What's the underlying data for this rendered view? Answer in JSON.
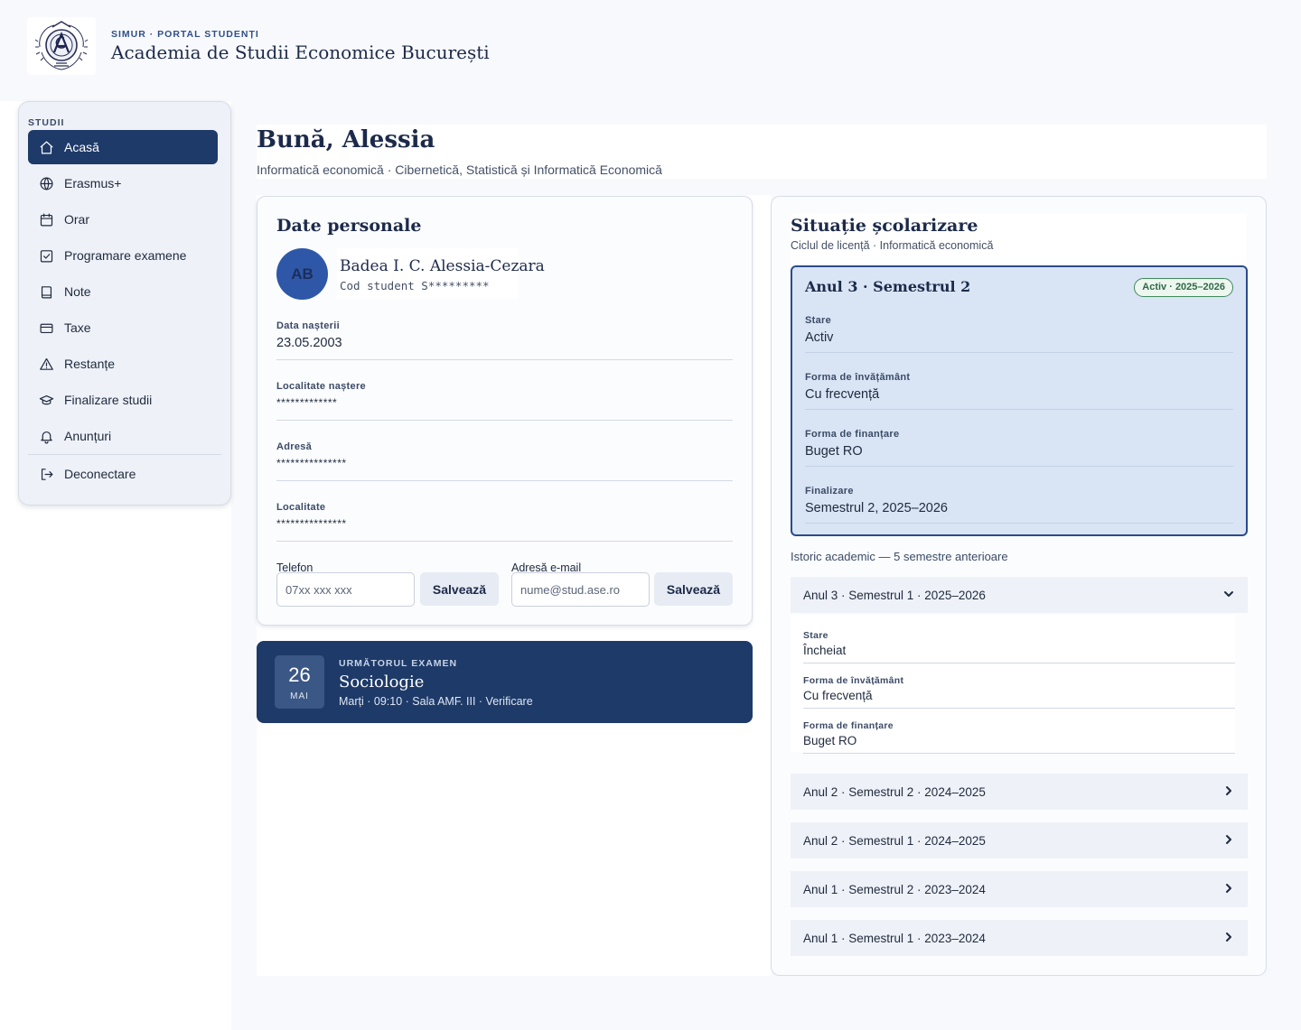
{
  "header": {
    "kicker": "SIMUR · PORTAL STUDENȚI",
    "title": "Academia de Studii Economice București"
  },
  "sidebar": {
    "section": "STUDII",
    "items": [
      {
        "label": "Acasă",
        "icon": "home-icon",
        "active": true
      },
      {
        "label": "Erasmus+",
        "icon": "globe-icon"
      },
      {
        "label": "Orar",
        "icon": "calendar-icon"
      },
      {
        "label": "Programare examene",
        "icon": "calendar-check-icon"
      },
      {
        "label": "Note",
        "icon": "book-icon"
      },
      {
        "label": "Taxe",
        "icon": "credit-card-icon"
      },
      {
        "label": "Restanțe",
        "icon": "warning-icon"
      },
      {
        "label": "Finalizare studii",
        "icon": "graduation-cap-icon"
      },
      {
        "label": "Anunțuri",
        "icon": "bell-icon"
      },
      {
        "label": "Deconectare",
        "icon": "logout-icon"
      }
    ]
  },
  "greeting": {
    "title": "Bună, Alessia",
    "subtitle": "Informatică economică · Cibernetică, Statistică și Informatică Economică"
  },
  "personal": {
    "title": "Date personale",
    "avatar_initials": "AB",
    "name": "Badea I. C. Alessia-Cezara",
    "student_code": "Cod student S*********",
    "fields": [
      {
        "label": "Data nașterii",
        "value": "23.05.2003"
      },
      {
        "label": "Localitate naștere",
        "value": "*************"
      },
      {
        "label": "Adresă",
        "value": "***************"
      },
      {
        "label": "Localitate",
        "value": "***************"
      }
    ],
    "phone": {
      "label": "Telefon",
      "placeholder": "07xx xxx xxx",
      "button": "Salvează"
    },
    "email": {
      "label": "Adresă e-mail",
      "placeholder": "nume@stud.ase.ro",
      "button": "Salvează"
    }
  },
  "next_exam": {
    "kicker": "URMĂTORUL EXAMEN",
    "day": "26",
    "month": "MAI",
    "title": "Sociologie",
    "meta": "Marți · 09:10 · Sala AMF. III · Verificare"
  },
  "schooling": {
    "title": "Situație școlarizare",
    "subtitle": "Ciclul de licență · Informatică economică",
    "current": {
      "title": "Anul 3 · Semestrul 2",
      "badge": "Activ · 2025–2026",
      "fields": [
        {
          "label": "Stare",
          "value": "Activ"
        },
        {
          "label": "Forma de învățământ",
          "value": "Cu frecvență"
        },
        {
          "label": "Forma de finanțare",
          "value": "Buget RO"
        },
        {
          "label": "Finalizare",
          "value": "Semestrul 2, 2025–2026"
        }
      ]
    },
    "history_title": "Istoric academic — 5 semestre anterioare",
    "history": [
      {
        "label": "Anul 3 · Semestrul 1 · 2025–2026",
        "expanded": true,
        "fields": [
          {
            "label": "Stare",
            "value": "Încheiat"
          },
          {
            "label": "Forma de învățământ",
            "value": "Cu frecvență"
          },
          {
            "label": "Forma de finanțare",
            "value": "Buget RO"
          }
        ]
      },
      {
        "label": "Anul 2 · Semestrul 2 · 2024–2025"
      },
      {
        "label": "Anul 2 · Semestrul 1 · 2024–2025"
      },
      {
        "label": "Anul 1 · Semestrul 2 · 2023–2024"
      },
      {
        "label": "Anul 1 · Semestrul 1 · 2023–2024"
      }
    ]
  },
  "colors": {
    "primary": "#1e3a68",
    "accent": "#2a4c8c",
    "success": "#3f8a5a"
  }
}
